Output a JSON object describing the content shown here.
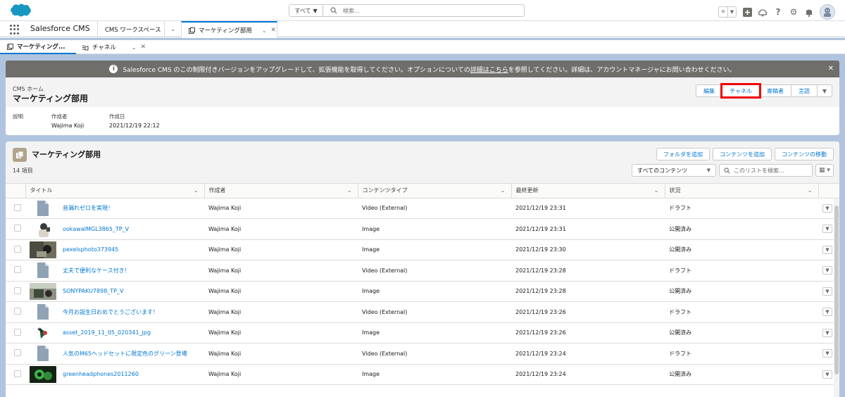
{
  "global_header": {
    "search_scope": "すべて",
    "search_placeholder": "検索..."
  },
  "app_nav": {
    "app_name": "Salesforce CMS",
    "tabs": [
      {
        "label": "CMS ワークスペース"
      },
      {
        "label": "マーケティング部用"
      }
    ]
  },
  "subtabs": [
    {
      "label": "マーケティング..."
    },
    {
      "label": "チャネル"
    }
  ],
  "banner": {
    "text_before": "Salesforce CMS のこの制限付きバージョンをアップグレードして、拡張機能を取得してください。オプションについての",
    "link": "詳細はこちら",
    "text_after": "を参照してください。詳細は、アカウントマネージャにお問い合わせください。"
  },
  "record": {
    "breadcrumb": "CMS ホーム",
    "title": "マーケティング部用",
    "actions": [
      "編集",
      "チャネル",
      "寄稿者",
      "言語"
    ],
    "fields": [
      {
        "label": "説明",
        "value": ""
      },
      {
        "label": "作成者",
        "value": "Wajima Koji"
      },
      {
        "label": "作成日",
        "value": "2021/12/19 22:12"
      }
    ]
  },
  "list": {
    "title": "マーケティング部用",
    "count": "14 項目",
    "buttons": [
      "フォルダを追加",
      "コンテンツを追加",
      "コンテンツの移動"
    ],
    "filter": "すべてのコンテンツ",
    "search_placeholder": "このリストを検索...",
    "columns": [
      "タイトル",
      "作成者",
      "コンテンツタイプ",
      "最終更新",
      "状況"
    ],
    "rows": [
      {
        "title": "音漏れゼロを実現！",
        "author": "Wajima Koji",
        "type": "Video (External)",
        "updated": "2021/12/19 23:31",
        "status": "ドラフト",
        "thumb": "doc"
      },
      {
        "title": "ookawaIMGL3865_TP_V",
        "author": "Wajima Koji",
        "type": "Image",
        "updated": "2021/12/19 23:31",
        "status": "公開済み",
        "thumb": "img1"
      },
      {
        "title": "pexelsphoto373945",
        "author": "Wajima Koji",
        "type": "Image",
        "updated": "2021/12/19 23:30",
        "status": "公開済み",
        "thumb": "img2"
      },
      {
        "title": "丈夫で便利なケース付き！",
        "author": "Wajima Koji",
        "type": "Video (External)",
        "updated": "2021/12/19 23:28",
        "status": "ドラフト",
        "thumb": "doc"
      },
      {
        "title": "SONYPAKU7898_TP_V",
        "author": "Wajima Koji",
        "type": "Image",
        "updated": "2021/12/19 23:28",
        "status": "公開済み",
        "thumb": "img3"
      },
      {
        "title": "今月お誕生日おめでとうございます！",
        "author": "Wajima Koji",
        "type": "Video (External)",
        "updated": "2021/12/19 23:26",
        "status": "ドラフト",
        "thumb": "doc"
      },
      {
        "title": "asset_2019_11_05_020341_jpg",
        "author": "Wajima Koji",
        "type": "Image",
        "updated": "2021/12/19 23:26",
        "status": "公開済み",
        "thumb": "img4"
      },
      {
        "title": "人気のM65ヘッドセットに限定色のグリーン登場",
        "author": "Wajima Koji",
        "type": "Video (External)",
        "updated": "2021/12/19 23:24",
        "status": "ドラフト",
        "thumb": "doc"
      },
      {
        "title": "greenheadphones2011260",
        "author": "Wajima Koji",
        "type": "Image",
        "updated": "2021/12/19 23:24",
        "status": "公開済み",
        "thumb": "img5"
      }
    ]
  },
  "colors": {
    "brand": "#0176d3",
    "highlight": "#e00000",
    "banner": "#706e6b"
  }
}
